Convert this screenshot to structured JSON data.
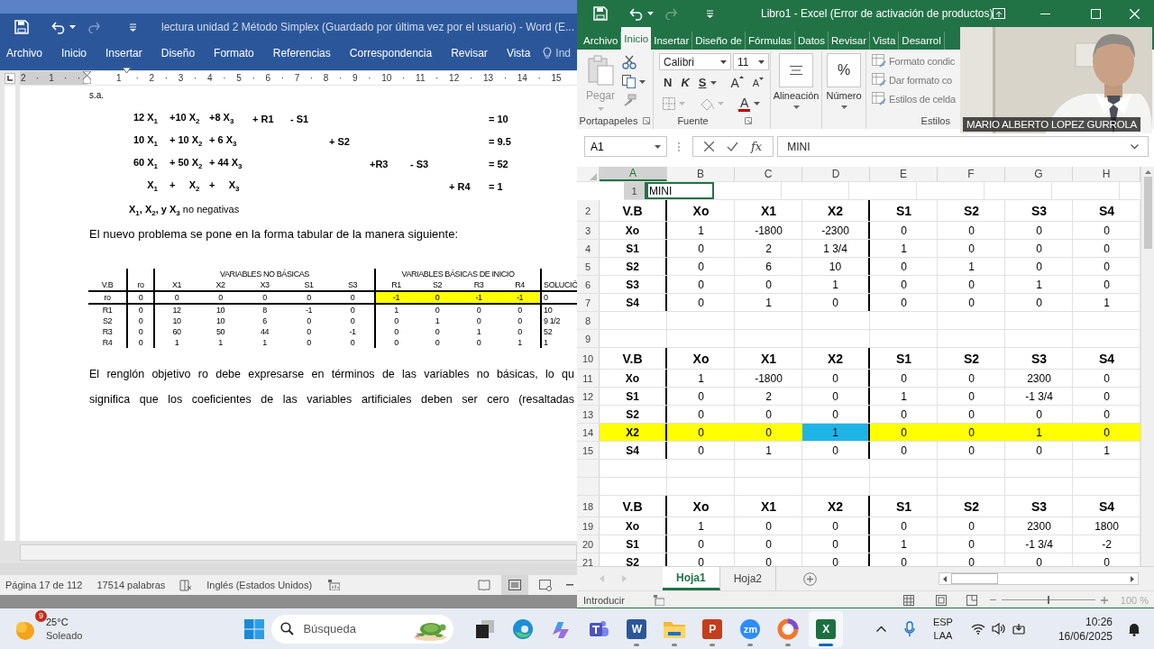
{
  "word": {
    "title": "lectura unidad 2 Método Simplex (Guardado por última vez por el usuario) - Word (E...",
    "tabs": [
      {
        "label": "Archivo",
        "selected": false
      },
      {
        "label": "Inicio",
        "selected": false
      },
      {
        "label": "Insertar",
        "selected": false
      },
      {
        "label": "Diseño",
        "selected": false
      },
      {
        "label": "Formato",
        "selected": false
      },
      {
        "label": "Referencias",
        "selected": false
      },
      {
        "label": "Correspondencia",
        "selected": false
      },
      {
        "label": "Revisar",
        "selected": false
      },
      {
        "label": "Vista",
        "selected": false
      }
    ],
    "tell_me": "Ind",
    "ruler": [
      "2 · 1 · ·",
      "1",
      "· 2 · 3 · 4 · 5 · 6 · 7 · 8 · 9 · 10 · 11 · 12 · 13 · 14 · 15"
    ],
    "doc": {
      "intro": "s.a.",
      "equations": [
        {
          "x1": "12 X$_{1}$",
          "x2": "+10 X$_{2}$",
          "x3": "+8 X$_{3}$",
          "r1": "+ R1",
          "s1": "- S1",
          "rhs": "= 10"
        },
        {
          "x1": "10 X$_{1}$",
          "x2": "+ 10 X$_{2}$",
          "x3": "+ 6 X$_{3}$",
          "s2": "+ S2",
          "rhs": "= 9.5"
        },
        {
          "x1": "60 X$_{1}$",
          "x2": "+ 50 X$_{2}$",
          "x3": "+ 44 X$_{3}$",
          "r3": "+R3",
          "s3": "- S3",
          "rhs": "= 52"
        },
        {
          "x1": "X$_{1}$",
          "x2": "+     X$_{2}$",
          "x3": "+     X$_{3}$",
          "r4": "+ R4",
          "rhs": "= 1"
        }
      ],
      "nonneg": "**X$_{1}$, X$_{2}$, y X$_{3}$** no negativas",
      "para1": "El nuevo problema se pone en la forma tabular de la manera siguiente:",
      "tableau": {
        "heading": [
          {
            "label": "V.B"
          },
          {
            "label": "ro"
          },
          {
            "group": "VARIABLES NO BÁSICAS",
            "kind": "nonbasic",
            "labels": [
              "X1",
              "X2",
              "X3",
              "S1",
              "S3"
            ]
          },
          {
            "group": "VARIABLES BÁSICAS DE INICIO",
            "kind": "basic",
            "labels": [
              "R1",
              "S2",
              "R3",
              "R4"
            ]
          },
          {
            "label": "SOLUCIÓ"
          }
        ],
        "rows": [
          {
            "highlighted": true,
            "cells": [
              "ro",
              "0",
              "0",
              "0",
              "0",
              "0",
              "0",
              "-1",
              "0",
              "-1",
              "-1",
              "0"
            ]
          },
          {
            "highlighted": false,
            "cells": [
              "R1",
              "0",
              "12",
              "10",
              "8",
              "-1",
              "0",
              "1",
              "0",
              "0",
              "0",
              "10"
            ]
          },
          {
            "highlighted": false,
            "cells": [
              "S2",
              "0",
              "10",
              "10",
              "6",
              "0",
              "0",
              "0",
              "1",
              "0",
              "0",
              "9 1/2"
            ]
          },
          {
            "highlighted": false,
            "cells": [
              "R3",
              "0",
              "60",
              "50",
              "44",
              "0",
              "-1",
              "0",
              "0",
              "1",
              "0",
              "52"
            ]
          },
          {
            "highlighted": false,
            "cells": [
              "R4",
              "0",
              "1",
              "1",
              "1",
              "0",
              "0",
              "0",
              "0",
              "0",
              "1",
              "1"
            ]
          }
        ]
      },
      "para2_lines": [
        "El renglón objetivo ro debe expresarse en términos de las variables no básicas, lo qu",
        "significa que los coeficientes de las variables artificiales deben ser cero (resaltadas"
      ]
    },
    "status": {
      "page": "Página 17 de 112",
      "words": "17514 palabras",
      "language": "Inglés (Estados Unidos)"
    }
  },
  "excel": {
    "title": "Libro1 - Excel (Error de activación de productos)",
    "tabs": [
      {
        "label": "Archivo",
        "selected": false
      },
      {
        "label": "Inicio",
        "selected": true
      },
      {
        "label": "Insertar",
        "selected": false
      },
      {
        "label": "Diseño de",
        "selected": false
      },
      {
        "label": "Fórmulas",
        "selected": false
      },
      {
        "label": "Datos",
        "selected": false
      },
      {
        "label": "Revisar",
        "selected": false
      },
      {
        "label": "Vista",
        "selected": false
      },
      {
        "label": "Desarrol",
        "selected": false
      }
    ],
    "ribbon": {
      "paste": "Pegar",
      "font": "Calibri",
      "size": "11",
      "bold": "N",
      "italic": "K",
      "underline": "S",
      "grow": "A",
      "shrink": "A",
      "font_color": "A",
      "alignment": "Alineación",
      "number": "Número",
      "percent": "%",
      "styles": [
        "Formato condic",
        "Dar formato co",
        "Estilos de celda"
      ],
      "groups": [
        "Portapapeles",
        "Fuente",
        "Estilos"
      ]
    },
    "formula_bar": {
      "name_box": "A1",
      "function": "fx",
      "value": "MINI"
    },
    "sheet": {
      "columns": [
        {
          "label": "A",
          "thick_border": true
        },
        {
          "label": "B",
          "thick_border": false
        },
        {
          "label": "C",
          "thick_border": false
        },
        {
          "label": "D",
          "thick_border": true
        },
        {
          "label": "E",
          "thick_border": false
        },
        {
          "label": "F",
          "thick_border": false
        },
        {
          "label": "G",
          "thick_border": false
        },
        {
          "label": "H",
          "thick_border": false
        }
      ],
      "rows": [
        {
          "num": "1",
          "kind": "title",
          "highlighted": false,
          "cells": [
            "MINI"
          ]
        },
        {
          "num": "2",
          "kind": "header",
          "highlighted": false,
          "cells": [
            "V.B",
            "Xo",
            "X1",
            "X2",
            "S1",
            "S2",
            "S3",
            "S4"
          ]
        },
        {
          "num": "3",
          "kind": "data",
          "highlighted": false,
          "cells": [
            "Xo",
            "1",
            "-1800",
            "-2300",
            "0",
            "0",
            "0",
            "0"
          ]
        },
        {
          "num": "4",
          "kind": "data",
          "highlighted": false,
          "cells": [
            "S1",
            "0",
            "2",
            "1 3/4",
            "1",
            "0",
            "0",
            "0"
          ]
        },
        {
          "num": "5",
          "kind": "data",
          "highlighted": false,
          "cells": [
            "S2",
            "0",
            "6",
            "10",
            "0",
            "1",
            "0",
            "0"
          ]
        },
        {
          "num": "6",
          "kind": "data",
          "highlighted": false,
          "cells": [
            "S3",
            "0",
            "0",
            "1",
            "0",
            "0",
            "1",
            "0"
          ]
        },
        {
          "num": "7",
          "kind": "data",
          "highlighted": false,
          "cells": [
            "S4",
            "0",
            "1",
            "0",
            "0",
            "0",
            "0",
            "1"
          ]
        },
        {
          "num": "8",
          "kind": "blank",
          "highlighted": false
        },
        {
          "num": "9",
          "kind": "blank",
          "highlighted": false
        },
        {
          "num": "10",
          "kind": "header",
          "highlighted": false,
          "cells": [
            "V.B",
            "Xo",
            "X1",
            "X2",
            "S1",
            "S2",
            "S3",
            "S4"
          ]
        },
        {
          "num": "11",
          "kind": "data",
          "highlighted": false,
          "cells": [
            "Xo",
            "1",
            "-1800",
            "0",
            "0",
            "0",
            "2300",
            "0"
          ]
        },
        {
          "num": "12",
          "kind": "data",
          "highlighted": false,
          "cells": [
            "S1",
            "0",
            "2",
            "0",
            "1",
            "0",
            "-1 3/4",
            "0"
          ]
        },
        {
          "num": "13",
          "kind": "data",
          "highlighted": false,
          "cells": [
            "S2",
            "0",
            "0",
            "0",
            "0",
            "0",
            "0",
            "0"
          ]
        },
        {
          "num": "14",
          "kind": "data",
          "highlighted": true,
          "cells": [
            "X2",
            "0",
            "0",
            {
              "text": "1",
              "pivot": true
            },
            "0",
            "0",
            "1",
            "0"
          ]
        },
        {
          "num": "15",
          "kind": "data",
          "highlighted": false,
          "cells": [
            "S4",
            "0",
            "1",
            "0",
            "0",
            "0",
            "0",
            "1"
          ]
        },
        {
          "kind": "blank",
          "highlighted": false
        },
        {
          "kind": "blank",
          "highlighted": false
        },
        {
          "num": "18",
          "kind": "header",
          "highlighted": false,
          "cells": [
            "V.B",
            "Xo",
            "X1",
            "X2",
            "S1",
            "S2",
            "S3",
            "S4"
          ]
        },
        {
          "num": "19",
          "kind": "data",
          "highlighted": false,
          "cells": [
            "Xo",
            "1",
            "0",
            "0",
            "0",
            "0",
            "2300",
            "1800"
          ]
        },
        {
          "num": "20",
          "kind": "data",
          "highlighted": false,
          "cells": [
            "S1",
            "0",
            "0",
            "0",
            "1",
            "0",
            "-1 3/4",
            "-2"
          ]
        },
        {
          "num": "21",
          "kind": "data",
          "highlighted": false,
          "cells": [
            "S2",
            "0",
            "0",
            "0",
            "0",
            "0",
            "0",
            "0"
          ]
        }
      ],
      "tabs": [
        {
          "label": "Hoja1",
          "selected": true
        },
        {
          "label": "Hoja2",
          "selected": false
        }
      ]
    },
    "status": {
      "mode": "Introducir",
      "zoom": "100 %",
      "zoom_slider": {
        "level": 0.5
      }
    }
  },
  "video": {
    "name": "MARIO ALBERTO LOPEZ GURROLA"
  },
  "taskbar": {
    "weather": {
      "badge": "9",
      "temp": "25°C",
      "condition": "Soleado"
    },
    "search": {
      "placeholder": "Búsqueda"
    },
    "apps": [
      {
        "kind": "taskview",
        "open": false,
        "selected": false
      },
      {
        "kind": "edge",
        "open": false,
        "selected": false
      },
      {
        "kind": "copilot",
        "open": false,
        "selected": false
      },
      {
        "kind": "teams",
        "open": false,
        "selected": false
      },
      {
        "kind": "word",
        "letter": "W",
        "open": true,
        "selected": false
      },
      {
        "kind": "explorer",
        "open": true,
        "selected": false
      },
      {
        "kind": "powerpoint",
        "letter": "P",
        "open": true,
        "selected": false
      },
      {
        "kind": "zoom",
        "letter": "zm",
        "open": true,
        "selected": false
      },
      {
        "kind": "browser",
        "open": true,
        "selected": false
      },
      {
        "kind": "excel",
        "letter": "X",
        "open": true,
        "selected": true
      }
    ],
    "language": {
      "code": "ESP",
      "layout": "LAA"
    },
    "clock": {
      "time": "10:26",
      "date": "16/06/2025"
    }
  }
}
